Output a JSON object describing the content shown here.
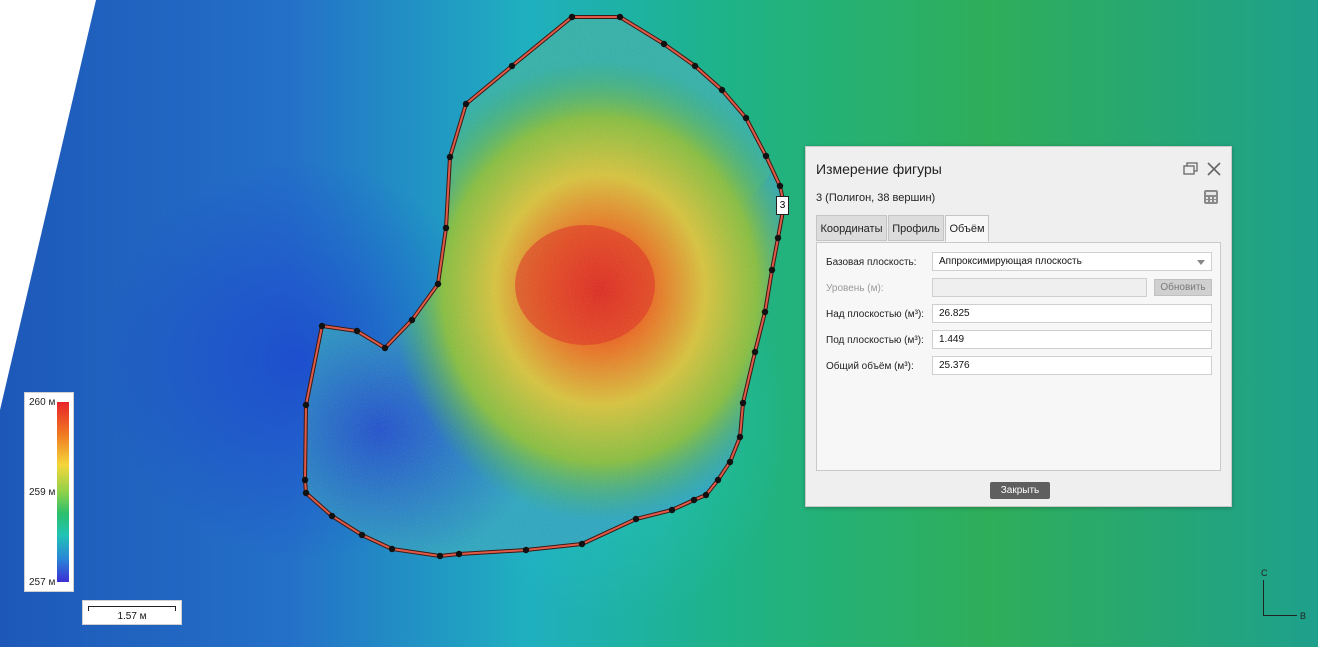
{
  "legend": {
    "max_label": "260 м",
    "mid_label": "259 м",
    "min_label": "257 м"
  },
  "scale_bar": {
    "label": "1.57 м"
  },
  "compass": {
    "north": "С",
    "east": "В"
  },
  "vertex_label": "3",
  "dialog": {
    "title": "Измерение фигуры",
    "subtitle": "3 (Полигон, 38 вершин)",
    "tabs": [
      {
        "label": "Координаты",
        "active": false
      },
      {
        "label": "Профиль",
        "active": false
      },
      {
        "label": "Объём",
        "active": true
      }
    ],
    "base_plane_label": "Базовая плоскость:",
    "base_plane_value": "Аппроксимирующая плоскость",
    "level_label": "Уровень (м):",
    "level_value": "",
    "refresh_label": "Обновить",
    "above_label": "Над плоскостью (м³):",
    "above_value": "26.825",
    "below_label": "Под плоскостью (м³):",
    "below_value": "1.449",
    "total_label": "Общий объём (м³):",
    "total_value": "25.376",
    "close_label": "Закрыть"
  },
  "colors": {
    "polygon_outline": "#e05a4a",
    "vertex": "#111111",
    "dialog_bg": "#efefef",
    "close_button": "#5f5f5f"
  }
}
